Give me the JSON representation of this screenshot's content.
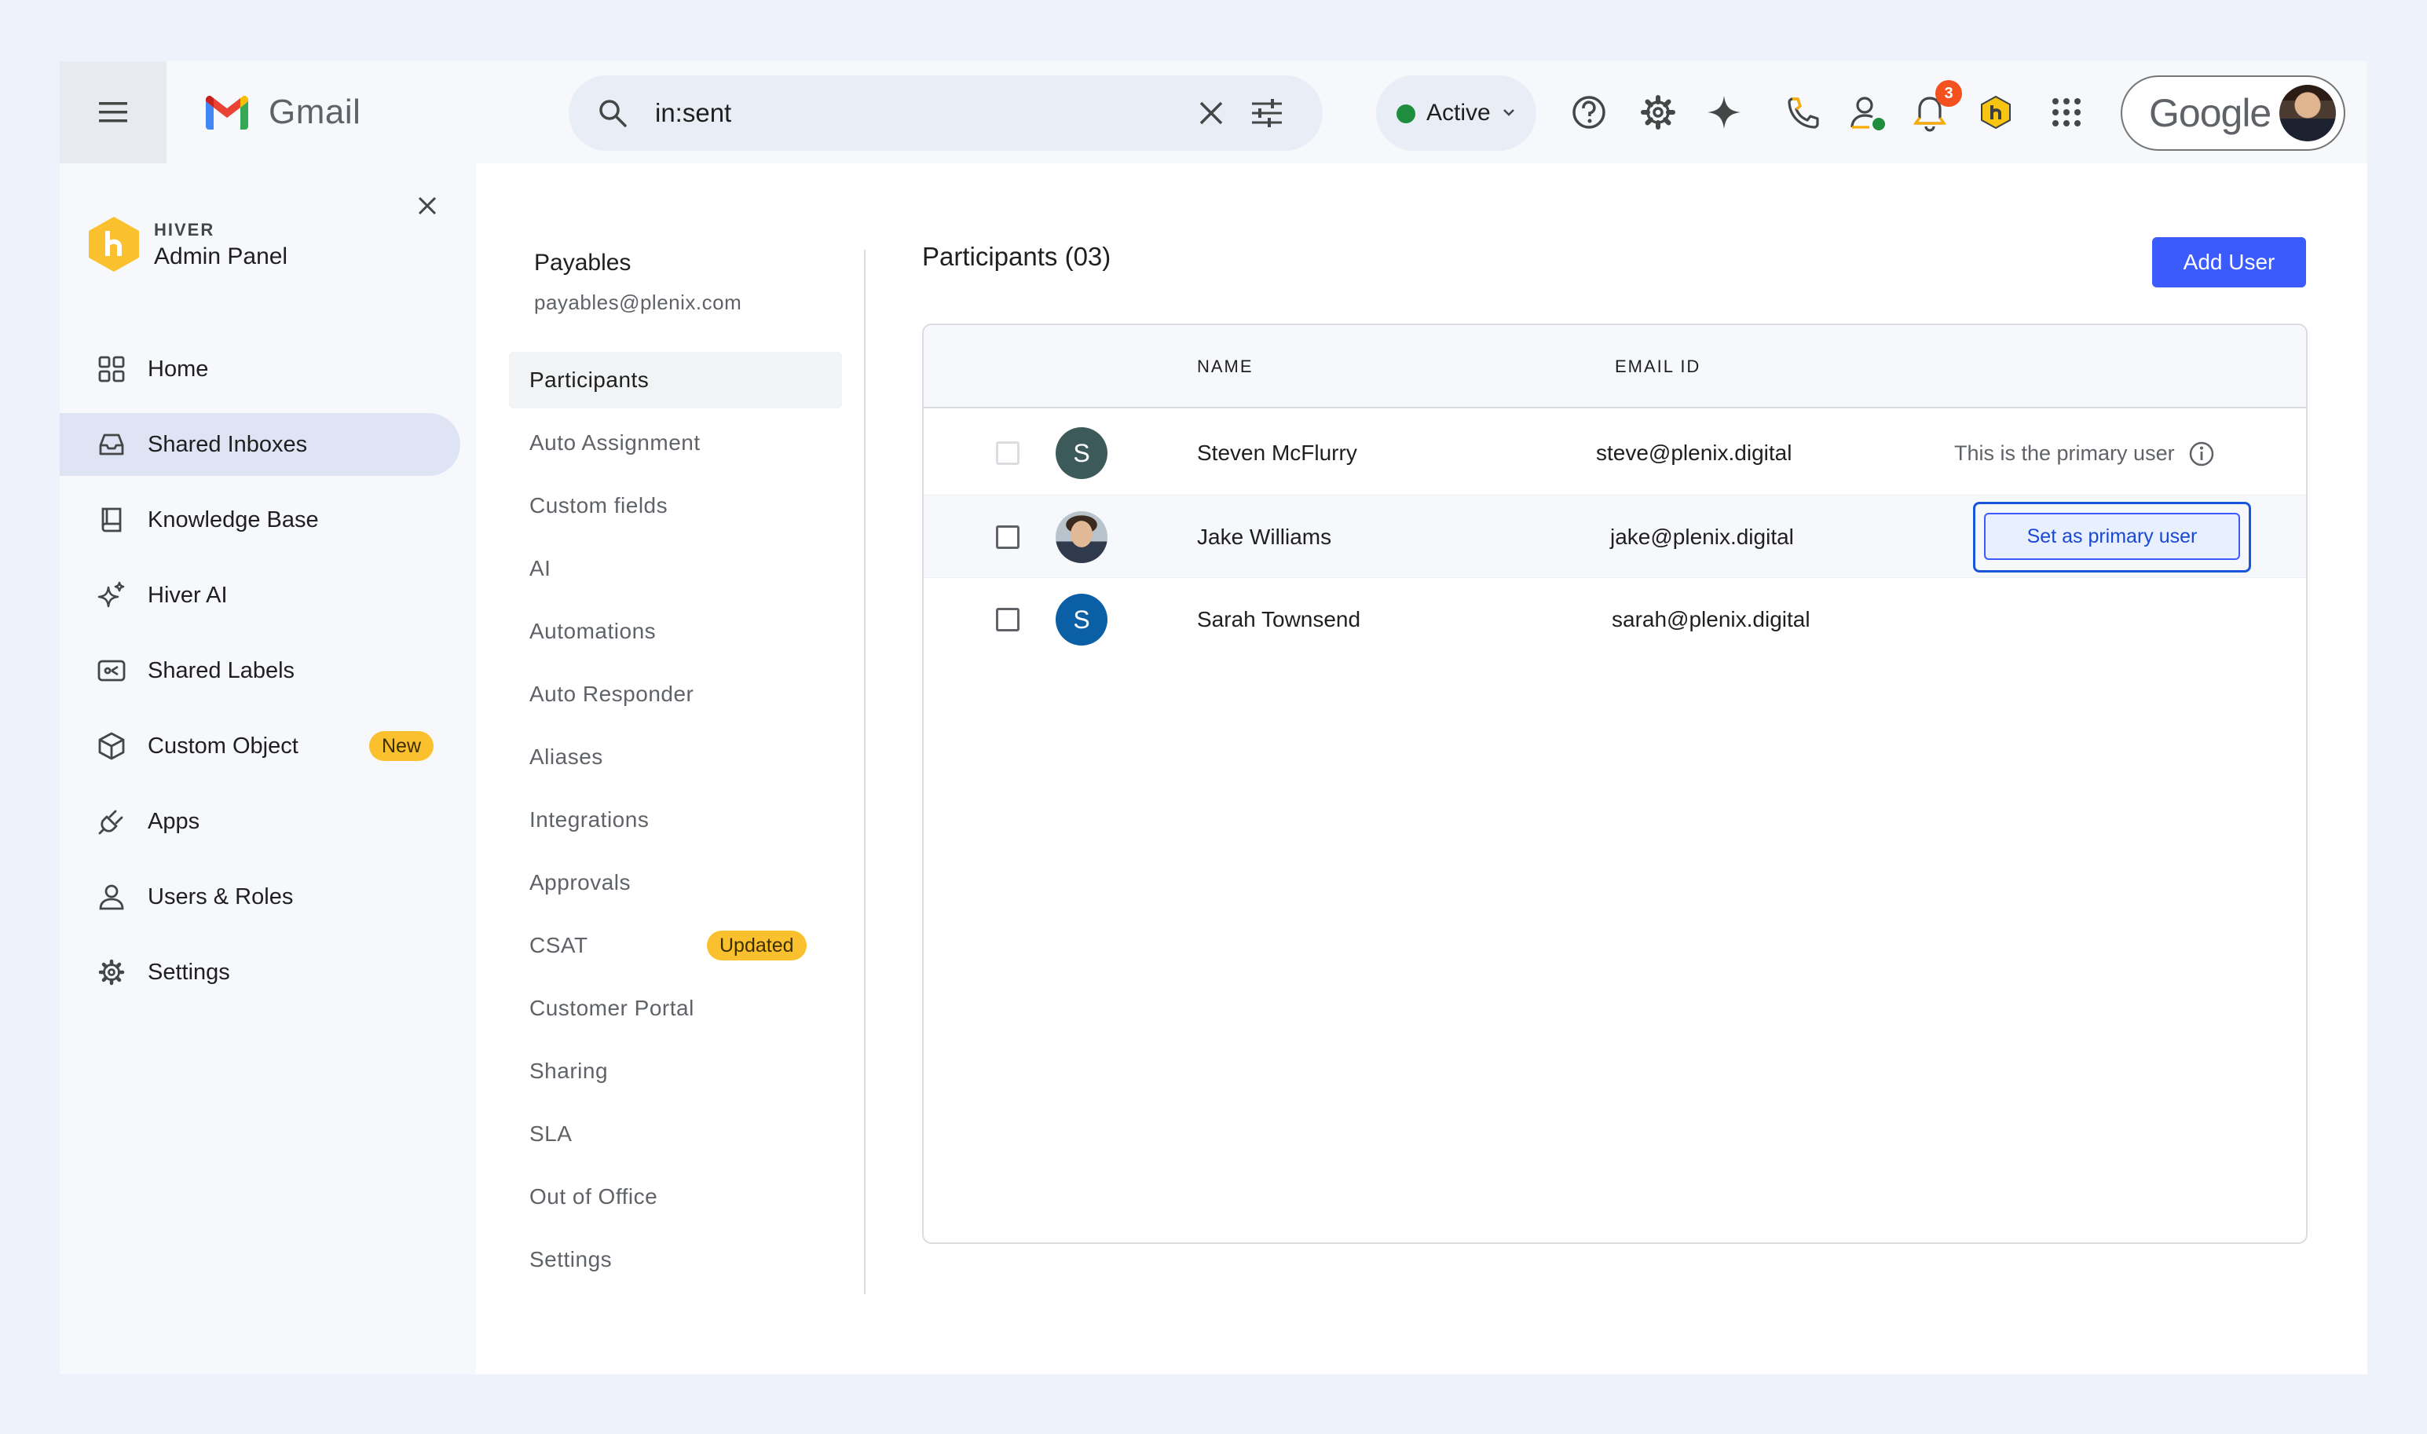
{
  "gmail": {
    "logo_text": "Gmail"
  },
  "search": {
    "query": "in:sent"
  },
  "status": {
    "label": "Active",
    "color": "#1e8e3e"
  },
  "notifications": {
    "count": "3"
  },
  "account": {
    "brand": "Google"
  },
  "admin_panel": {
    "brand_small": "HIVER",
    "title": "Admin Panel"
  },
  "sidebar": {
    "items": [
      {
        "label": "Home",
        "icon": "grid-icon"
      },
      {
        "label": "Shared Inboxes",
        "icon": "inbox-icon",
        "active": true
      },
      {
        "label": "Knowledge Base",
        "icon": "book-icon"
      },
      {
        "label": "Hiver AI",
        "icon": "sparkle-icon"
      },
      {
        "label": "Shared Labels",
        "icon": "label-icon"
      },
      {
        "label": "Custom Object",
        "icon": "cube-icon",
        "badge": "New"
      },
      {
        "label": "Apps",
        "icon": "plug-icon"
      },
      {
        "label": "Users & Roles",
        "icon": "user-icon"
      },
      {
        "label": "Settings",
        "icon": "gear-icon"
      }
    ]
  },
  "inbox": {
    "name": "Payables",
    "email": "payables@plenix.com"
  },
  "settings_nav": {
    "items": [
      {
        "label": "Participants",
        "active": true
      },
      {
        "label": "Auto Assignment"
      },
      {
        "label": "Custom fields"
      },
      {
        "label": "AI"
      },
      {
        "label": "Automations"
      },
      {
        "label": "Auto Responder"
      },
      {
        "label": "Aliases"
      },
      {
        "label": "Integrations"
      },
      {
        "label": "Approvals"
      },
      {
        "label": "CSAT",
        "badge": "Updated"
      },
      {
        "label": "Customer Portal"
      },
      {
        "label": "Sharing"
      },
      {
        "label": "SLA"
      },
      {
        "label": "Out of Office"
      },
      {
        "label": "Settings"
      }
    ]
  },
  "participants": {
    "title": "Participants (03)",
    "add_button": "Add User",
    "columns": [
      "NAME",
      "EMAIL ID"
    ],
    "rows": [
      {
        "initial": "S",
        "name": "Steven McFlurry",
        "email": "steve@plenix.digital",
        "note": "This is the primary user",
        "avatar_color": "#3d5a5b"
      },
      {
        "photo": true,
        "name": "Jake Williams",
        "email": "jake@plenix.digital",
        "action": "Set as primary user"
      },
      {
        "initial": "S",
        "name": "Sarah Townsend",
        "email": "sarah@plenix.digital",
        "avatar_color": "#0b5fa5"
      }
    ]
  }
}
